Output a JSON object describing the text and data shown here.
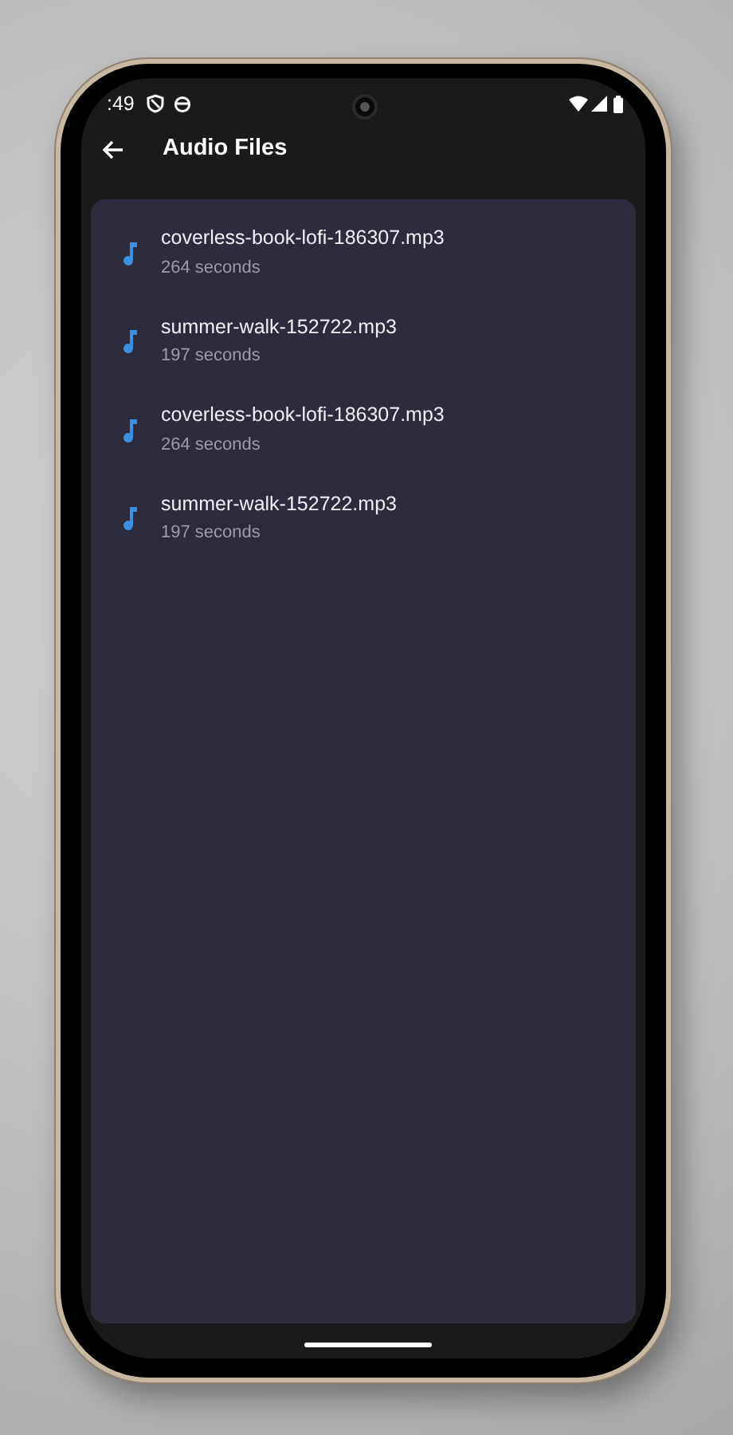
{
  "status_bar": {
    "time": ":49"
  },
  "app_bar": {
    "title": "Audio Files"
  },
  "files": [
    {
      "name": "coverless-book-lofi-186307.mp3",
      "duration": "264 seconds"
    },
    {
      "name": "summer-walk-152722.mp3",
      "duration": "197 seconds"
    },
    {
      "name": "coverless-book-lofi-186307.mp3",
      "duration": "264 seconds"
    },
    {
      "name": "summer-walk-152722.mp3",
      "duration": "197 seconds"
    }
  ]
}
